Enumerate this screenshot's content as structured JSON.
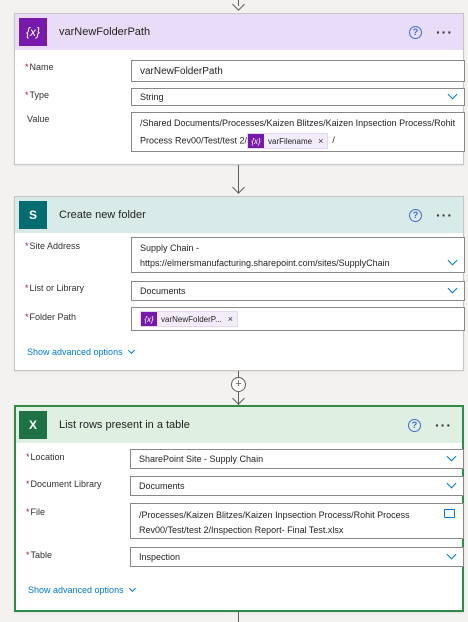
{
  "cards": {
    "var": {
      "title": "varNewFolderPath",
      "icon_label": "{x}",
      "fields": {
        "name": {
          "label": "Name",
          "value": "varNewFolderPath"
        },
        "type": {
          "label": "Type",
          "value": "String"
        },
        "value": {
          "label": "Value",
          "line1": "/Shared Documents/Processes/Kaizen Blitzes/Kaizen Inpsection Process/Rohit",
          "line2": "Process Rev00/Test/test 2/",
          "token": "varFilename",
          "suffix": "/"
        }
      }
    },
    "folder": {
      "title": "Create new folder",
      "icon_label": "S",
      "fields": {
        "site": {
          "label": "Site Address",
          "line1": "Supply Chain -",
          "line2": "https://elmersmanufacturing.sharepoint.com/sites/SupplyChain"
        },
        "list": {
          "label": "List or Library",
          "value": "Documents"
        },
        "path": {
          "label": "Folder Path",
          "token": "varNewFolderP..."
        }
      },
      "advanced": "Show advanced options"
    },
    "rows": {
      "title": "List rows present in a table",
      "icon_label": "X",
      "fields": {
        "location": {
          "label": "Location",
          "value": "SharePoint Site - Supply Chain"
        },
        "library": {
          "label": "Document Library",
          "value": "Documents"
        },
        "file": {
          "label": "File",
          "line1": "/Processes/Kaizen Blitzes/Kaizen Inpsection Process/Rohit Process",
          "line2": "Rev00/Test/test 2/Inspection Report- Final Test.xlsx"
        },
        "table": {
          "label": "Table",
          "value": "Inspection"
        }
      },
      "advanced": "Show advanced options"
    }
  },
  "help_glyph": "?",
  "more_glyph": "···",
  "plus_glyph": "+",
  "token_close": "×",
  "token_icon": "{x}",
  "required_mark": "*",
  "colors": {
    "var_header": "#e8dcf8",
    "var_icon": "#7719aa",
    "sp_header": "#d9ebe8",
    "sp_icon": "#036c70",
    "xl_header": "#dff0e3",
    "xl_icon": "#1f7244",
    "link": "#0078d4"
  }
}
